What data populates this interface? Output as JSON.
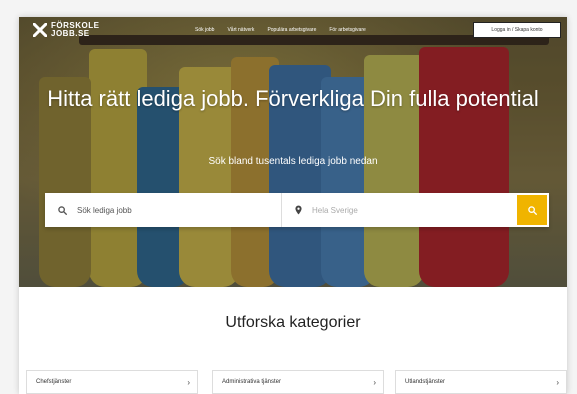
{
  "header": {
    "logo_text": "FÖRSKOLE JOBB.SE",
    "nav": [
      "Sök jobb",
      "Vårt nätverk",
      "Populära arbetsgivare",
      "För arbetsgivare"
    ],
    "login_label": "Logga in / Skapa konto"
  },
  "hero": {
    "headline": "Hitta rätt lediga jobb. Förverkliga Din fulla potential",
    "subline": "Sök bland tusentals lediga jobb nedan"
  },
  "search": {
    "what_placeholder": "Sök lediga jobb",
    "where_placeholder": "Hela Sverige",
    "accent_color": "#f0b400"
  },
  "categories": {
    "title": "Utforska kategorier",
    "items": [
      "Chefstjänster",
      "Administrativa tjänster",
      "Utlandstjänster"
    ]
  }
}
